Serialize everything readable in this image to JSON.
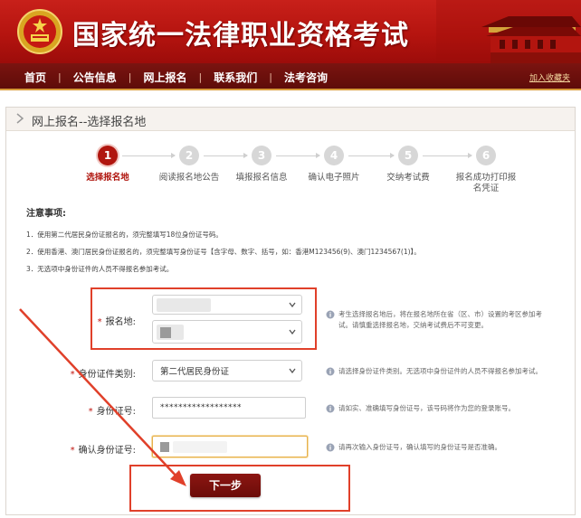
{
  "header": {
    "site_title": "国家统一法律职业资格考试"
  },
  "nav": {
    "items": [
      "首页",
      "公告信息",
      "网上报名",
      "联系我们",
      "法考咨询"
    ],
    "separator": "|",
    "favorite": "加入收藏夹"
  },
  "panel": {
    "title": "网上报名--选择报名地"
  },
  "steps": [
    {
      "number": "1",
      "label": "选择报名地",
      "active": true
    },
    {
      "number": "2",
      "label": "阅读报名地公告",
      "active": false
    },
    {
      "number": "3",
      "label": "填报报名信息",
      "active": false
    },
    {
      "number": "4",
      "label": "确认电子照片",
      "active": false
    },
    {
      "number": "5",
      "label": "交纳考试费",
      "active": false
    },
    {
      "number": "6",
      "label": "报名成功打印报名凭证",
      "active": false
    }
  ],
  "notes": {
    "title": "注意事项:",
    "items": [
      "1．使用第二代居民身份证报名的，须完整填写18位身份证号码。",
      "2．使用香港、澳门居民身份证报名的，须完整填写身份证号【含字母、数字、括号，如：香港M123456(9)、澳门1234567(1)】。",
      "3．无选项中身份证件的人员不得报名参加考试。"
    ]
  },
  "form": {
    "required_mark": "*",
    "location": {
      "label": "报名地:",
      "hint": "考生选择报名地后，将在报名地所在省（区、市）设置的考区参加考试。请慎重选择报名地，交纳考试费后不可变更。"
    },
    "id_type": {
      "label": "身份证件类别:",
      "value": "第二代居民身份证",
      "hint": "请选择身份证件类别。无选项中身份证件的人员不得报名参加考试。"
    },
    "id_number": {
      "label": "身份证号:",
      "value": "******************",
      "hint": "请如实、准确填写身份证号，该号码将作为您的登录账号。"
    },
    "id_confirm": {
      "label": "确认身份证号:",
      "hint": "请再次输入身份证号，确认填写的身份证号是否准确。"
    },
    "next_button": "下一步"
  },
  "colors": {
    "brand_red": "#b0160f",
    "nav_dark": "#5e0c09",
    "annotation_red": "#e0402a"
  }
}
